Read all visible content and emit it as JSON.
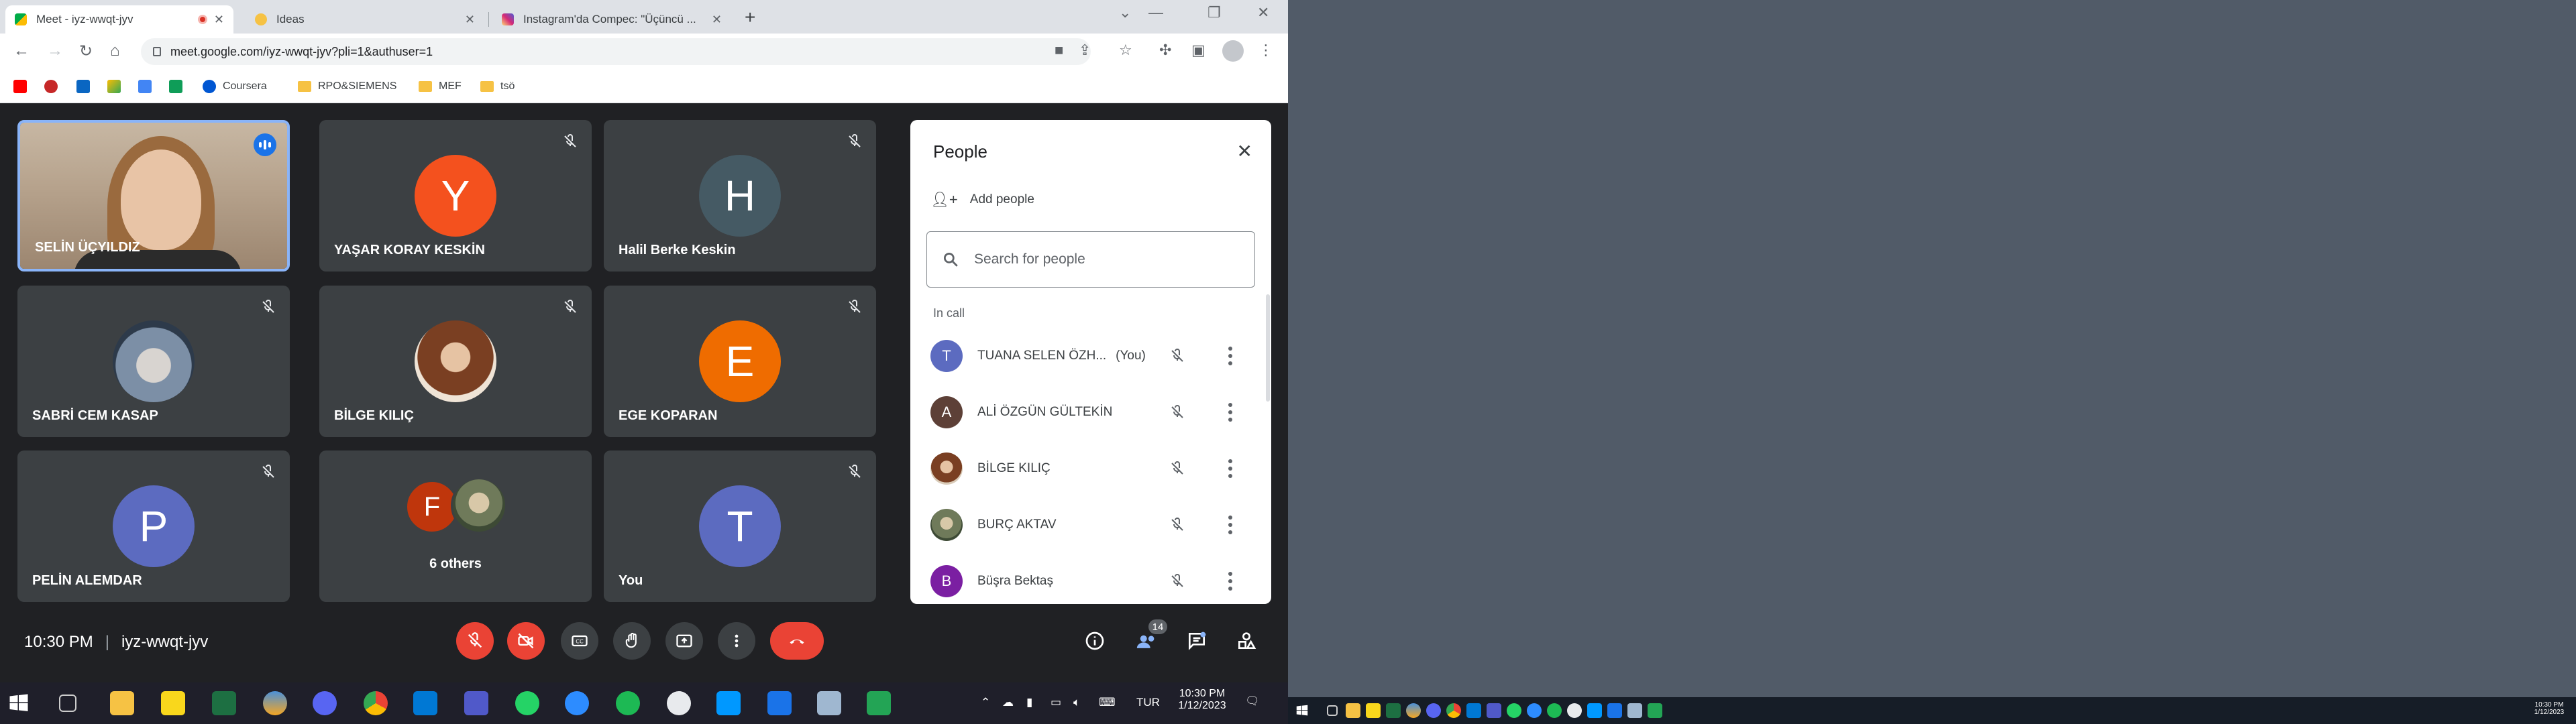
{
  "browser": {
    "tabs": [
      {
        "title": "Meet - iyz-wwqt-jyv",
        "recording": true
      },
      {
        "title": "Ideas"
      },
      {
        "title": "Instagram'da Compec: \"Üçüncü ..."
      }
    ],
    "url": "meet.google.com/iyz-wwqt-jyv?pli=1&authuser=1",
    "bookmarks": [
      "Coursera",
      "RPO&SIEMENS",
      "MEF",
      "tsö"
    ]
  },
  "meet": {
    "tiles": [
      {
        "name": "SELİN ÜÇYILDIZ",
        "type": "video",
        "speaking": true
      },
      {
        "name": "YAŞAR KORAY KESKİN",
        "initial": "Y",
        "color": "#f4511e",
        "muted": true
      },
      {
        "name": "Halil Berke Keskin",
        "initial": "H",
        "color": "#455a64",
        "muted": true
      },
      {
        "name": "SABRİ CEM KASAP",
        "type": "photo",
        "muted": true
      },
      {
        "name": "BİLGE KILIÇ",
        "type": "photo",
        "muted": true
      },
      {
        "name": "EGE KOPARAN",
        "initial": "E",
        "color": "#ef6c00",
        "muted": true
      },
      {
        "name": "PELİN ALEMDAR",
        "initial": "P",
        "color": "#5c6bc0",
        "muted": true
      },
      {
        "name": "6 others",
        "initial": "F",
        "color": "#bf360c",
        "type": "group"
      },
      {
        "name": "You",
        "initial": "T",
        "color": "#5c6bc0",
        "muted": true
      }
    ],
    "time": "10:30 PM",
    "meeting_code": "iyz-wwqt-jyv",
    "participant_count": "14"
  },
  "people_panel": {
    "title": "People",
    "add_people": "Add people",
    "search_placeholder": "Search for people",
    "section": "In call",
    "people": [
      {
        "name": "TUANA SELEN ÖZH...",
        "suffix": "(You)",
        "initial": "T",
        "color": "#5c6bc0"
      },
      {
        "name": "ALİ ÖZGÜN GÜLTEKİN",
        "initial": "A",
        "color": "#5d4037"
      },
      {
        "name": "BİLGE KILIÇ",
        "initial": "",
        "color": "#8d5a3b"
      },
      {
        "name": "BURÇ AKTAV",
        "initial": "",
        "color": "#6b7a5a"
      },
      {
        "name": "Büşra Bektaş",
        "initial": "B",
        "color": "#7b1fa2"
      }
    ]
  },
  "taskbar": {
    "language": "TUR",
    "time": "10:30 PM",
    "date": "1/12/2023"
  },
  "taskbar2": {
    "time": "10:30 PM",
    "date": "1/12/2023"
  }
}
